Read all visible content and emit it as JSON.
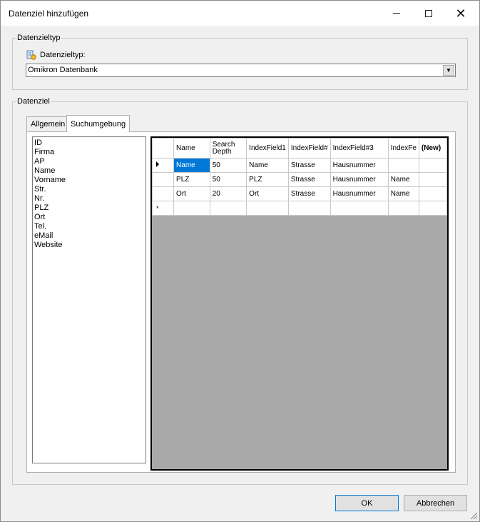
{
  "window": {
    "title": "Datenziel hinzufügen",
    "controls": {
      "minimize": "—",
      "maximize": "☐",
      "close": "✕"
    }
  },
  "datenzieltyp_group": {
    "legend": "Datenzieltyp",
    "label": "Datenzieltyp:",
    "icon": "database-icon",
    "combo_value": "Omikron Datenbank"
  },
  "datenziel_group": {
    "legend": "Datenziel",
    "tabs": [
      {
        "label": "Allgemein",
        "active": false
      },
      {
        "label": "Suchumgebung",
        "active": true
      }
    ],
    "field_list": [
      "ID",
      "Firma",
      "AP",
      "Name",
      "Vorname",
      "Str.",
      "Nr.",
      "PLZ",
      "Ort",
      "Tel.",
      "eMail",
      "Website"
    ],
    "grid": {
      "columns": [
        "Name",
        "Search Depth",
        "IndexField1",
        "IndexField#",
        "IndexField#3",
        "IndexFe",
        "(New)"
      ],
      "rows": [
        [
          "Name",
          "50",
          "Name",
          "Strasse",
          "Hausnummer",
          "",
          ""
        ],
        [
          "PLZ",
          "50",
          "PLZ",
          "Strasse",
          "Hausnummer",
          "Name",
          ""
        ],
        [
          "Ort",
          "20",
          "Ort",
          "Strasse",
          "Hausnummer",
          "Name",
          ""
        ]
      ],
      "selected_cell": {
        "row": 0,
        "col": 0
      },
      "new_row_marker": "*"
    }
  },
  "buttons": {
    "ok": "OK",
    "cancel": "Abbrechen"
  }
}
